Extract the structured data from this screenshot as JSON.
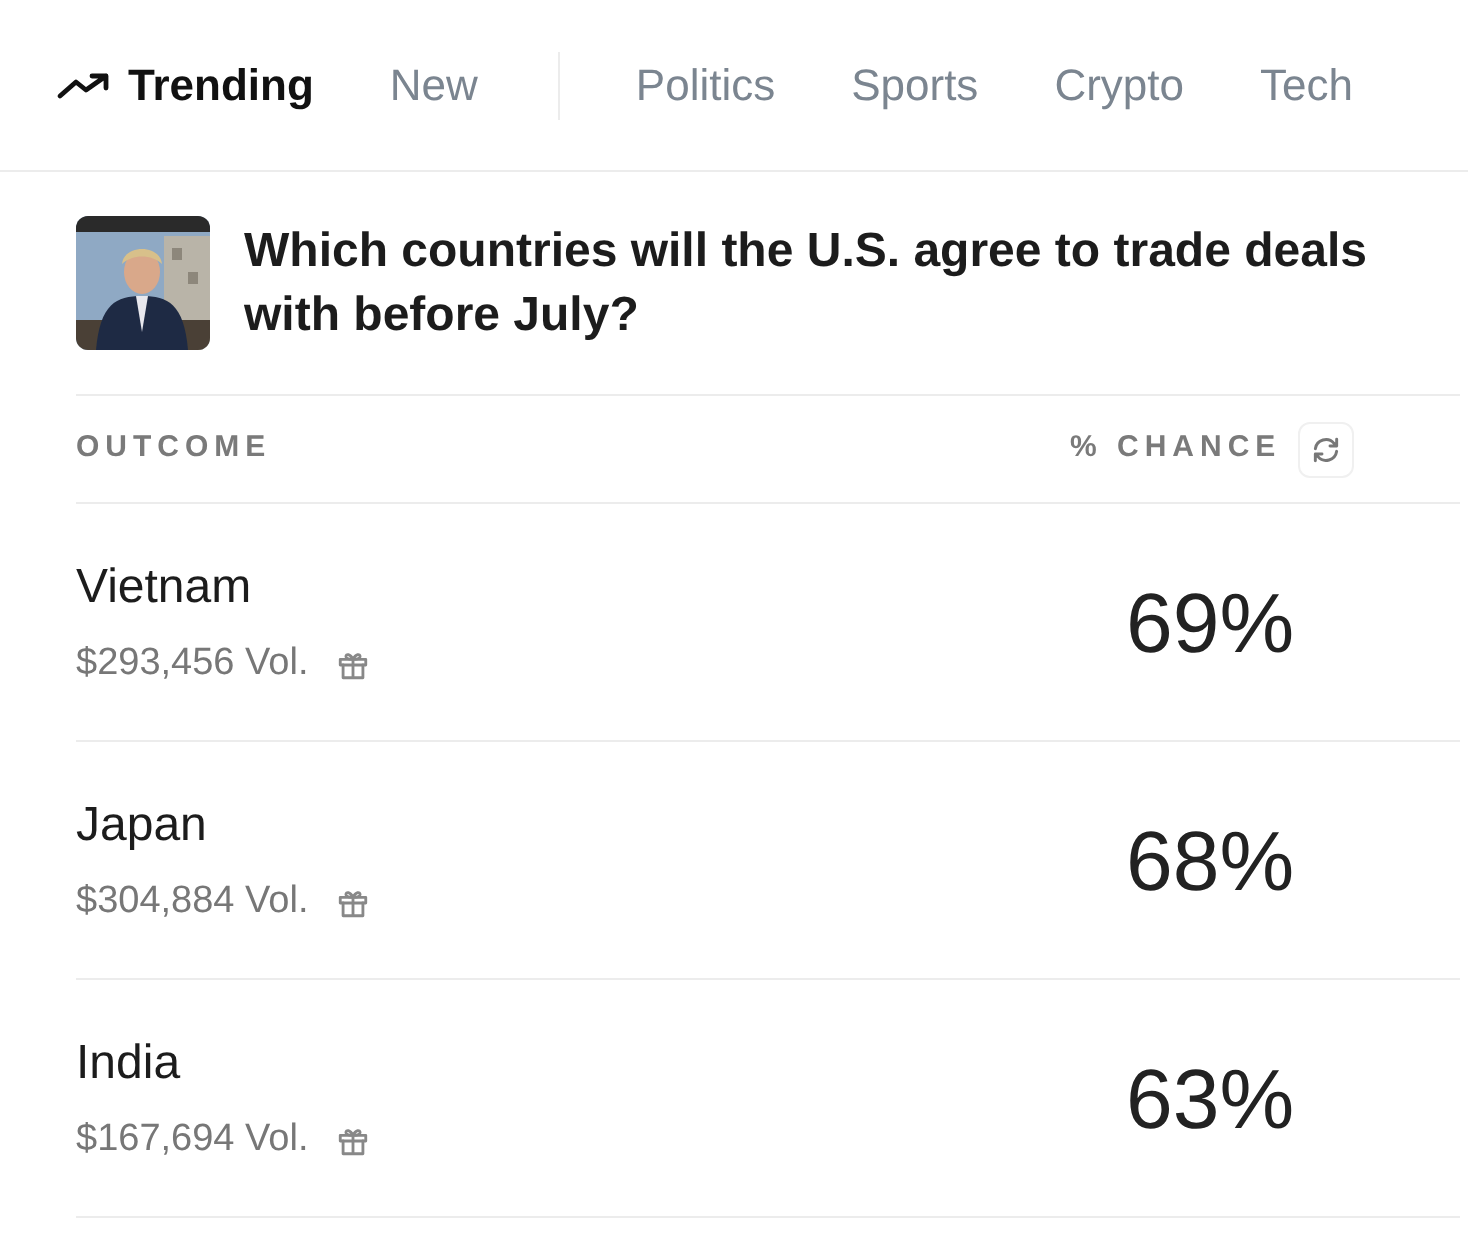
{
  "tabs": [
    {
      "label": "Trending",
      "selected": true
    },
    {
      "label": "New",
      "selected": false
    },
    {
      "label": "Politics",
      "selected": false
    },
    {
      "label": "Sports",
      "selected": false
    },
    {
      "label": "Crypto",
      "selected": false
    },
    {
      "label": "Tech",
      "selected": false
    }
  ],
  "market": {
    "question": "Which countries will the U.S. agree to trade deals with before July?"
  },
  "table": {
    "columns": [
      "OUTCOME",
      "% CHANCE"
    ],
    "rows": [
      {
        "name": "Vietnam",
        "volume": "$293,456 Vol.",
        "chance": "69%"
      },
      {
        "name": "Japan",
        "volume": "$304,884 Vol.",
        "chance": "68%"
      },
      {
        "name": "India",
        "volume": "$167,694 Vol.",
        "chance": "63%"
      }
    ]
  }
}
